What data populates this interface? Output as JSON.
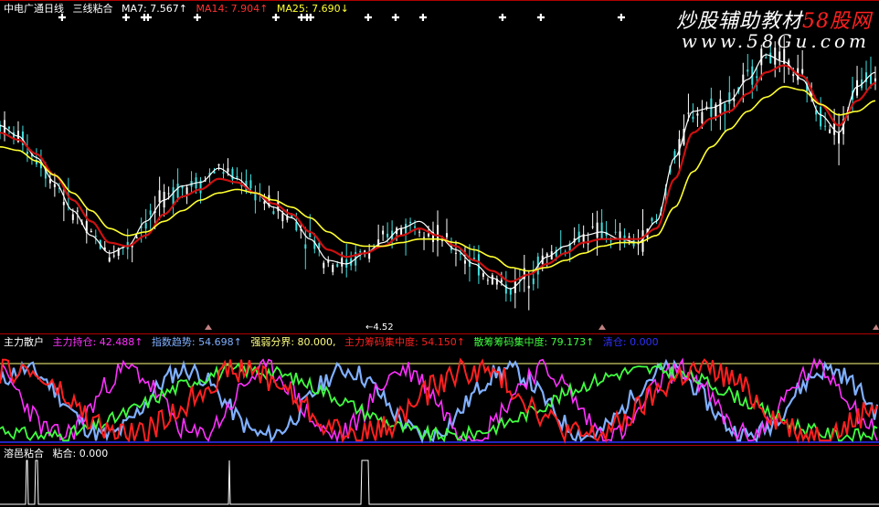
{
  "main_panel": {
    "title": "中电广通日线",
    "indicator": "三线粘合",
    "ma7": "MA7: 7.567↑",
    "ma14": "MA14: 7.904↑",
    "ma25": "MA25: 7.690↓",
    "low_label": "←4.52",
    "watermark_cn": "炒股辅助教材",
    "watermark_brand": "58股网",
    "watermark_url": "www.58Gu.com"
  },
  "indicator_panel": {
    "title": "主力散户",
    "main_hold": "主力持仓: 42.488↑",
    "index_trend": "指数趋势: 54.698↑",
    "strong_weak": "强弱分界: 80.000,",
    "main_chip": "主力筹码集中度: 54.150↑",
    "retail_chip": "散筹筹码集中度: 79.173↑",
    "cleanup": "清仓: 0.000"
  },
  "bottom_panel": {
    "title": "溶邑粘合",
    "value": "粘合: 0.000"
  },
  "colors": {
    "background": "#000000",
    "pane_border": "#b00000",
    "ma7": "#ffffff",
    "ma14": "#cc1010",
    "ma25": "#ffff30",
    "main_hold": "#ff30ff",
    "index_trend": "#80b0ff",
    "strong_weak": "#ffff80",
    "main_chip": "#ff2020",
    "retail_chip": "#40ff40",
    "cleanup": "#3030ff"
  },
  "chart_data": {
    "type": "line",
    "x": [
      0,
      1,
      2,
      3,
      4,
      5,
      6,
      7,
      8,
      9,
      10,
      11,
      12,
      13,
      14,
      15,
      16,
      17,
      18,
      19,
      20,
      21,
      22,
      23,
      24,
      25,
      26,
      27,
      28,
      29,
      30,
      31,
      32,
      33,
      34,
      35,
      36,
      37,
      38,
      39,
      40,
      41,
      42,
      43,
      44,
      45,
      46,
      47,
      48
    ],
    "series": [
      {
        "name": "MA7",
        "values": [
          9.5,
          9.2,
          8.6,
          7.9,
          7.1,
          6.4,
          5.9,
          6.1,
          6.8,
          7.4,
          7.8,
          7.9,
          8.3,
          8.0,
          7.6,
          7.2,
          6.9,
          6.3,
          5.7,
          5.6,
          5.9,
          6.2,
          6.6,
          6.8,
          6.4,
          6.0,
          5.6,
          5.2,
          4.9,
          5.3,
          5.8,
          6.1,
          6.4,
          6.5,
          6.3,
          6.2,
          6.8,
          8.6,
          9.9,
          10.0,
          10.2,
          10.8,
          11.5,
          11.3,
          10.8,
          9.8,
          9.3,
          10.6,
          11.0
        ]
      },
      {
        "name": "MA14",
        "values": [
          9.3,
          9.1,
          8.7,
          8.1,
          7.4,
          6.8,
          6.2,
          6.1,
          6.4,
          7.0,
          7.5,
          7.7,
          8.0,
          7.9,
          7.6,
          7.3,
          7.0,
          6.5,
          6.0,
          5.8,
          5.9,
          6.1,
          6.4,
          6.6,
          6.4,
          6.1,
          5.7,
          5.4,
          5.1,
          5.3,
          5.6,
          5.9,
          6.2,
          6.3,
          6.3,
          6.3,
          6.6,
          8.0,
          9.3,
          9.7,
          9.9,
          10.4,
          11.0,
          11.2,
          10.9,
          10.1,
          9.5,
          10.2,
          10.7
        ]
      },
      {
        "name": "MA25",
        "values": [
          8.9,
          8.8,
          8.5,
          8.1,
          7.6,
          7.1,
          6.6,
          6.4,
          6.5,
          6.8,
          7.1,
          7.4,
          7.6,
          7.7,
          7.6,
          7.4,
          7.2,
          6.9,
          6.5,
          6.2,
          6.1,
          6.1,
          6.2,
          6.3,
          6.3,
          6.2,
          6.0,
          5.8,
          5.5,
          5.4,
          5.5,
          5.7,
          5.9,
          6.1,
          6.2,
          6.2,
          6.4,
          7.2,
          8.2,
          8.9,
          9.4,
          9.9,
          10.3,
          10.6,
          10.5,
          10.1,
          9.8,
          9.9,
          10.2
        ]
      }
    ],
    "ylim": [
      4.0,
      12.5
    ]
  }
}
